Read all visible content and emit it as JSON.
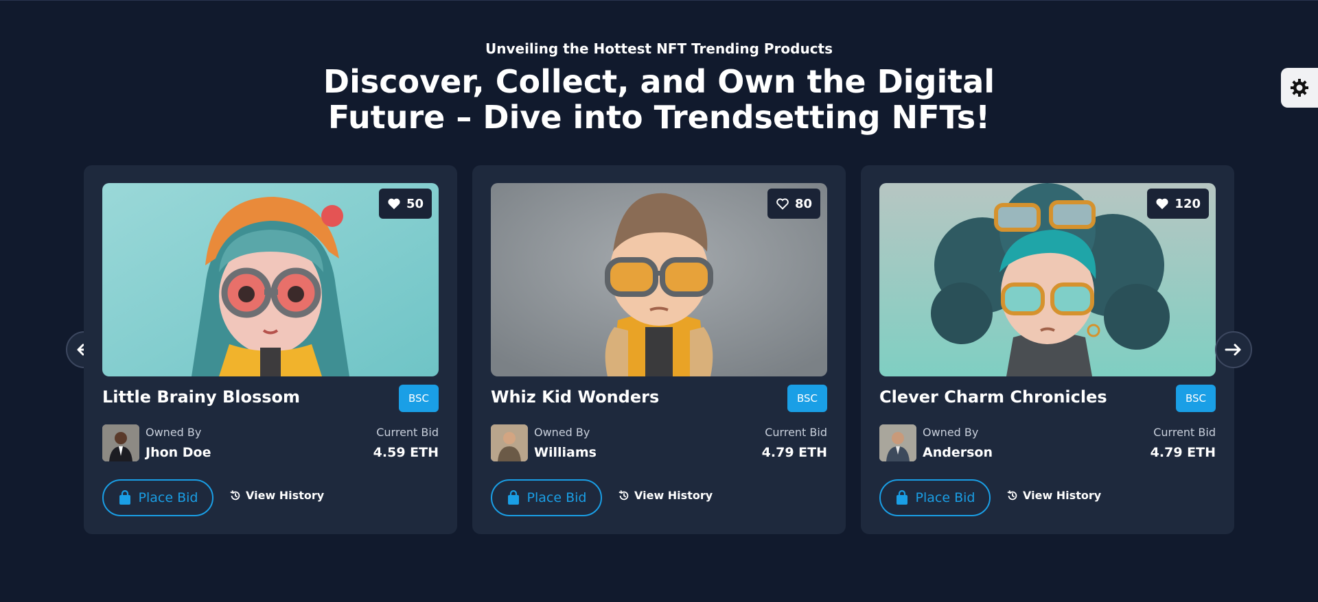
{
  "header": {
    "eyebrow": "Unveiling the Hottest NFT Trending Products",
    "headline": "Discover, Collect, and Own the Digital Future – Dive into Trendsetting NFTs!"
  },
  "theme_toggle": {
    "icon": "gear-icon"
  },
  "colors": {
    "page_bg": "#111a2d",
    "card_bg": "#1e293d",
    "accent": "#1a9fe6",
    "muted_text": "#c9d0dc"
  },
  "cards": [
    {
      "likes": "50",
      "title": "Little Brainy Blossom",
      "chain": "BSC",
      "owner_label": "Owned By",
      "owner": "Jhon Doe",
      "bid_label": "Current Bid",
      "bid": "4.59 ETH",
      "place_bid": "Place Bid",
      "view_history": "View History"
    },
    {
      "likes": "80",
      "title": "Whiz Kid Wonders",
      "chain": "BSC",
      "owner_label": "Owned By",
      "owner": "Williams",
      "bid_label": "Current Bid",
      "bid": "4.79 ETH",
      "place_bid": "Place Bid",
      "view_history": "View History"
    },
    {
      "likes": "120",
      "title": "Clever Charm Chronicles",
      "chain": "BSC",
      "owner_label": "Owned By",
      "owner": "Anderson",
      "bid_label": "Current Bid",
      "bid": "4.79 ETH",
      "place_bid": "Place Bid",
      "view_history": "View History"
    }
  ],
  "carousel": {
    "prev_icon": "arrow-left-icon",
    "next_icon": "arrow-right-icon"
  }
}
